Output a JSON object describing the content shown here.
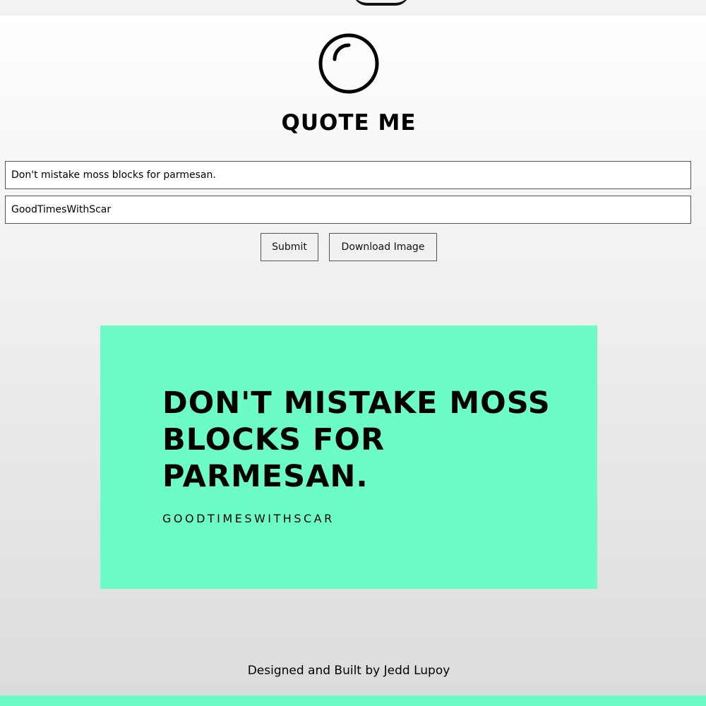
{
  "app": {
    "title": "QUOTE ME",
    "logo_icon": "circle-logo-icon"
  },
  "form": {
    "quote_value": "Don't mistake moss blocks for parmesan.",
    "author_value": "GoodTimesWithScar",
    "submit_label": "Submit",
    "download_label": "Download Image"
  },
  "card": {
    "quote": "Don't mistake moss blocks for parmesan.",
    "author": "GOODTIMESWITHSCAR",
    "background_color": "#6cfcc5"
  },
  "footer": {
    "credit": "Designed and Built by Jedd Lupoy"
  }
}
